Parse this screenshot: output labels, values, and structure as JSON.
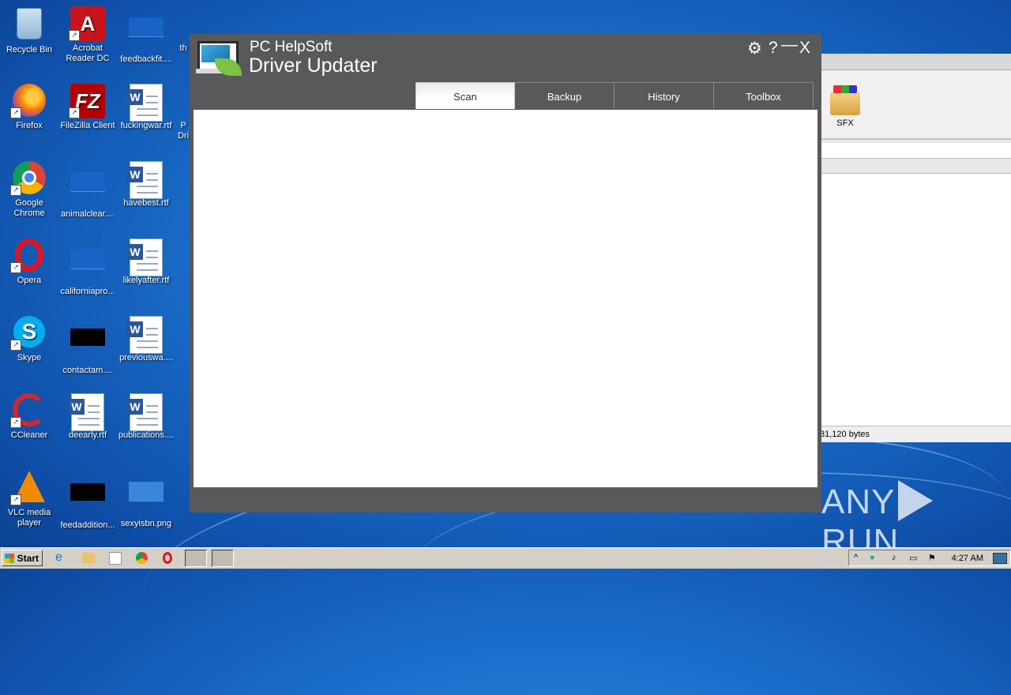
{
  "desktop": {
    "icons": [
      {
        "label": "Recycle Bin",
        "icon": "recycle-bin-icon"
      },
      {
        "label": "Acrobat Reader DC",
        "icon": "acrobat-icon"
      },
      {
        "label": "feedbackfit....",
        "icon": "file-icon"
      },
      {
        "label": "th",
        "icon": "file-icon"
      },
      {
        "label": "Firefox",
        "icon": "firefox-icon"
      },
      {
        "label": "FileZilla Client",
        "icon": "filezilla-icon"
      },
      {
        "label": "fuckingwar.rtf",
        "icon": "word-doc-icon"
      },
      {
        "label": "P Dri",
        "icon": "file-icon"
      },
      {
        "label": "Google Chrome",
        "icon": "chrome-icon"
      },
      {
        "label": "animalclear....",
        "icon": "file-icon"
      },
      {
        "label": "havebest.rtf",
        "icon": "word-doc-icon"
      },
      {
        "label": "Opera",
        "icon": "opera-icon"
      },
      {
        "label": "californiapro...",
        "icon": "file-icon"
      },
      {
        "label": "likelyafter.rtf",
        "icon": "word-doc-icon"
      },
      {
        "label": "Skype",
        "icon": "skype-icon"
      },
      {
        "label": "contactam....",
        "icon": "file-icon"
      },
      {
        "label": "previouswa....",
        "icon": "word-doc-icon"
      },
      {
        "label": "CCleaner",
        "icon": "ccleaner-icon"
      },
      {
        "label": "deearly.rtf",
        "icon": "word-doc-icon"
      },
      {
        "label": "publications....",
        "icon": "word-doc-icon"
      },
      {
        "label": "VLC media player",
        "icon": "vlc-icon"
      },
      {
        "label": "feedaddition...",
        "icon": "file-icon"
      },
      {
        "label": "sexyisbn.png",
        "icon": "image-icon"
      }
    ]
  },
  "bg_window": {
    "toolbar_item": "SFX",
    "status_text": "31,120 bytes"
  },
  "app": {
    "brand_line1": "PC HelpSoft",
    "brand_line2": "Driver Updater",
    "controls": {
      "settings": "⚙",
      "help": "?",
      "minimize": "—",
      "close": "X"
    },
    "tabs": [
      {
        "label": "Scan",
        "active": true
      },
      {
        "label": "Backup",
        "active": false
      },
      {
        "label": "History",
        "active": false
      },
      {
        "label": "Toolbox",
        "active": false
      }
    ]
  },
  "watermark": {
    "left": "ANY",
    "right": "RUN"
  },
  "taskbar": {
    "start_label": "Start",
    "clock": "4:27 AM",
    "colors": {
      "taskbar": "#d4d0c8",
      "desktop": "#1a6fcc",
      "app_frame": "#58595b"
    }
  }
}
